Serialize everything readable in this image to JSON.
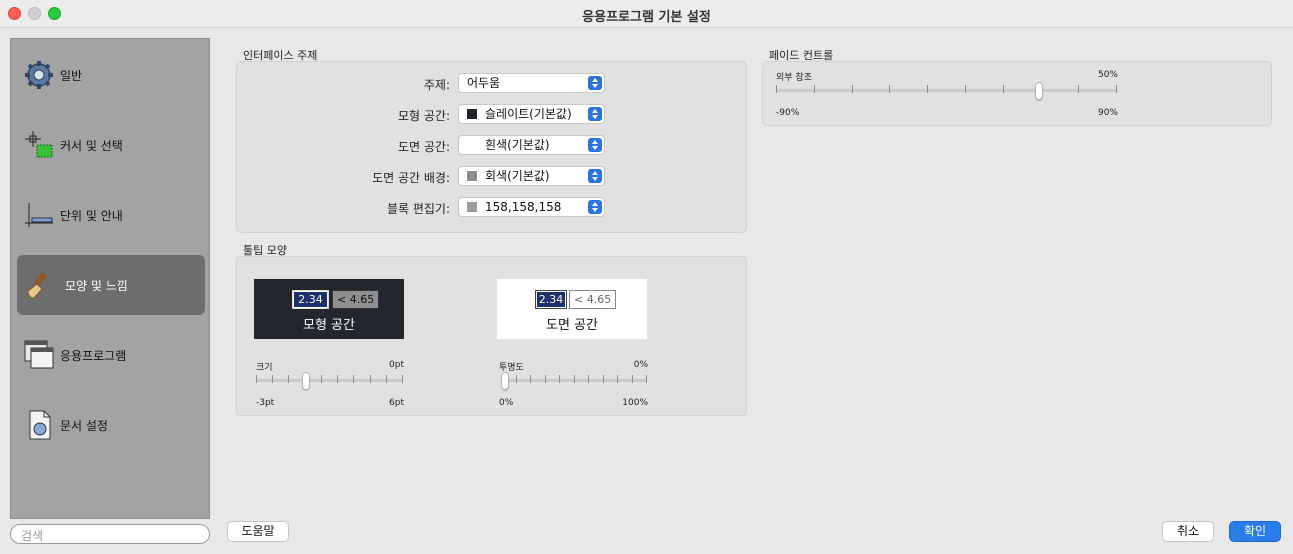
{
  "window": {
    "title": "응용프로그램 기본 설정"
  },
  "sidebar": {
    "items": [
      {
        "label": "일반",
        "icon": "gear-icon"
      },
      {
        "label": "커서 및 선택",
        "icon": "cursor-selection-icon"
      },
      {
        "label": "단위 및 안내",
        "icon": "units-guides-icon"
      },
      {
        "label": "모양 및 느낌",
        "icon": "brush-icon",
        "selected": true
      },
      {
        "label": "응용프로그램",
        "icon": "windows-icon"
      },
      {
        "label": "문서 설정",
        "icon": "document-icon"
      }
    ],
    "search_placeholder": "검색"
  },
  "interface_theme": {
    "title": "인터페이스 주제",
    "rows": [
      {
        "label": "주제:",
        "value": "어두움",
        "swatch": null
      },
      {
        "label": "모형 공간:",
        "value": "슬레이트(기본값)",
        "swatch": "#22252b"
      },
      {
        "label": "도면 공간:",
        "value": "흰색(기본값)",
        "swatch": "#ffffff"
      },
      {
        "label": "도면 공간 배경:",
        "value": "회색(기본값)",
        "swatch": "#8e8e8e"
      },
      {
        "label": "블록 편집기:",
        "value": "158,158,158",
        "swatch": "#9e9e9e"
      }
    ]
  },
  "tooltip": {
    "title": "툴팁 모양",
    "model_preview": {
      "value1": "2.34",
      "value2": "< 4.65",
      "label": "모형 공간"
    },
    "paper_preview": {
      "value1": "2.34",
      "value2": "< 4.65",
      "label": "도면 공간"
    },
    "size": {
      "label": "크기",
      "current": "0pt",
      "min": "-3pt",
      "max": "6pt",
      "value": 0,
      "range": [
        -3,
        6
      ]
    },
    "opacity": {
      "label": "투명도",
      "current": "0%",
      "min": "0%",
      "max": "100%",
      "value": 0,
      "range": [
        0,
        100
      ]
    }
  },
  "fade": {
    "title": "페이드 컨트롤",
    "xref": {
      "label": "외부 참조",
      "current": "50%",
      "min": "-90%",
      "max": "90%",
      "value": 50,
      "range": [
        -90,
        90
      ]
    }
  },
  "buttons": {
    "help": "도움말",
    "cancel": "취소",
    "ok": "확인"
  },
  "colors": {
    "accent": "#2b7de9",
    "sidebar_selected": "#6d6d6d",
    "sidebar_bg": "#a3a3a3"
  }
}
